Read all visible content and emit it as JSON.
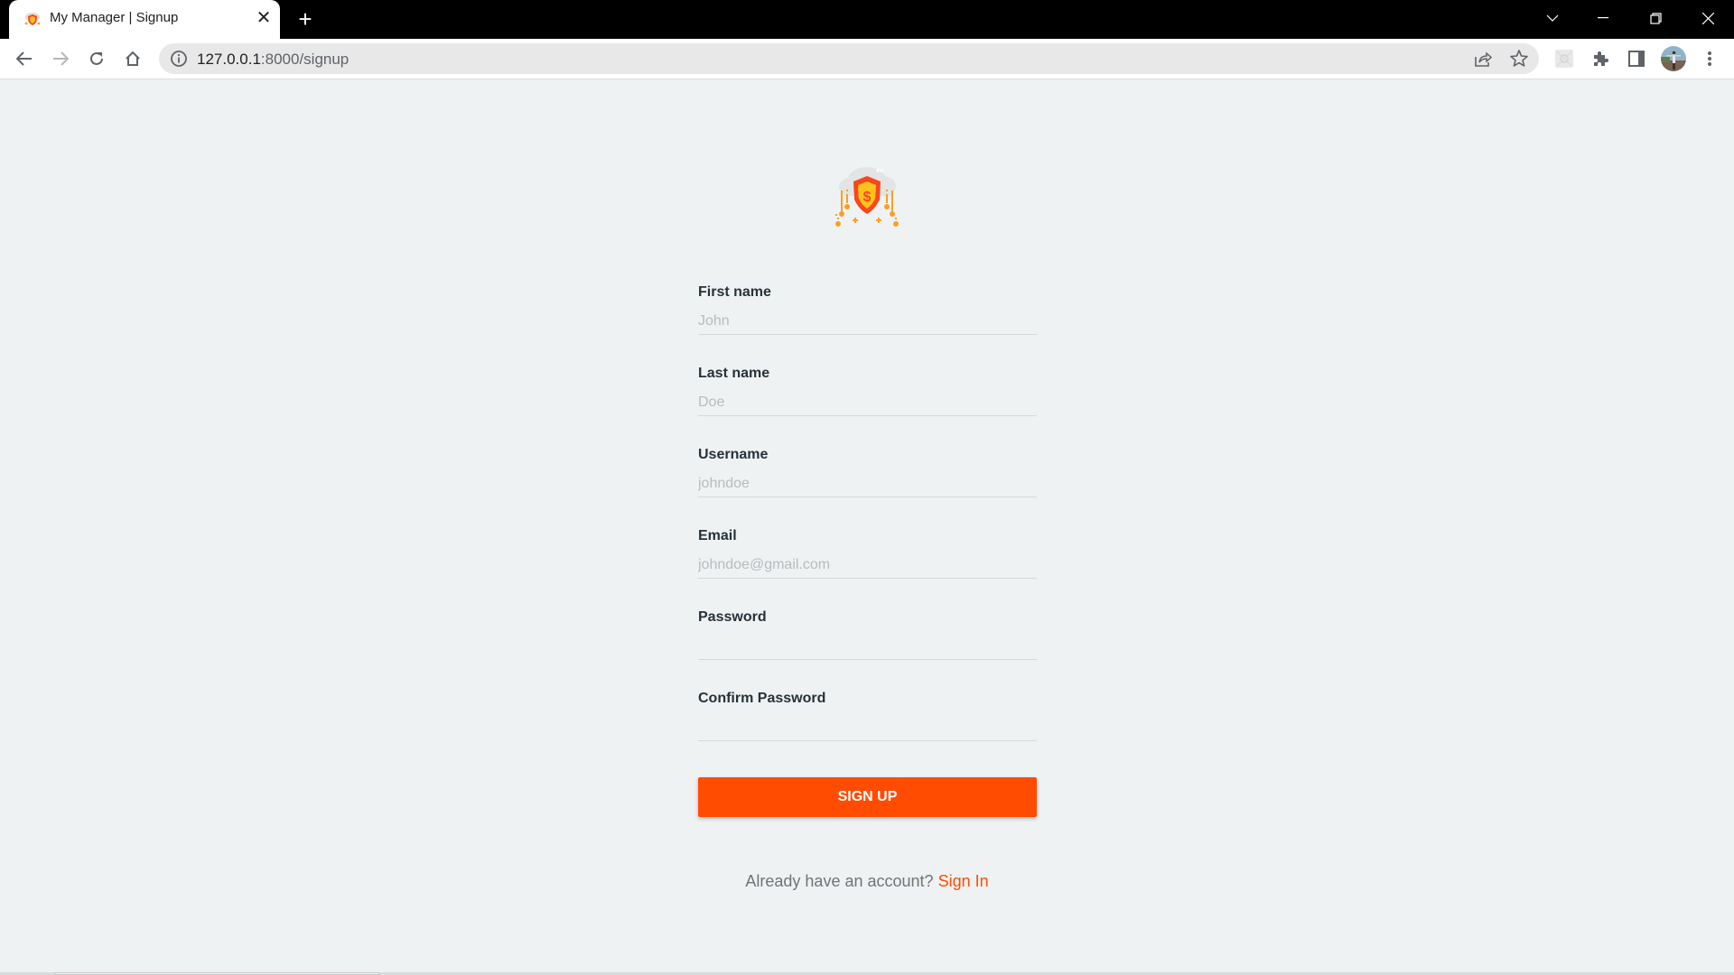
{
  "browser": {
    "tab": {
      "title": "My Manager | Signup",
      "favicon": "shield-cloud-favicon",
      "close_icon": "close-icon"
    },
    "new_tab_icon": "plus-icon",
    "window_controls": [
      "tab-search",
      "minimize",
      "restore",
      "close"
    ],
    "nav": {
      "back": "arrow-left-icon",
      "forward": "arrow-right-icon",
      "reload": "reload-icon",
      "home": "home-icon"
    },
    "omnibox": {
      "info_icon": "info-icon",
      "url_host": "127.0.0.1",
      "url_rest": ":8000/signup",
      "actions": [
        "share-icon",
        "star-icon"
      ]
    },
    "extensions": [
      "extension-icon",
      "puzzle-icon",
      "sidebar-icon",
      "profile-avatar",
      "kebab-menu-icon"
    ]
  },
  "page": {
    "logo": "shield-dollar-cloud-logo",
    "colors": {
      "accent": "#ff4c00",
      "background": "#eff2f3",
      "label": "#263238",
      "placeholder": "#b8bcbf"
    },
    "form": {
      "fields": [
        {
          "label": "First name",
          "placeholder": "John",
          "type": "text",
          "value": ""
        },
        {
          "label": "Last name",
          "placeholder": "Doe",
          "type": "text",
          "value": ""
        },
        {
          "label": "Username",
          "placeholder": "johndoe",
          "type": "text",
          "value": ""
        },
        {
          "label": "Email",
          "placeholder": "johndoe@gmail.com",
          "type": "email",
          "value": ""
        },
        {
          "label": "Password",
          "placeholder": "",
          "type": "password",
          "value": ""
        },
        {
          "label": "Confirm Password",
          "placeholder": "",
          "type": "password",
          "value": ""
        }
      ],
      "submit_label": "SIGN UP"
    },
    "signin": {
      "prompt": "Already have an account?",
      "link_label": "Sign In"
    }
  }
}
